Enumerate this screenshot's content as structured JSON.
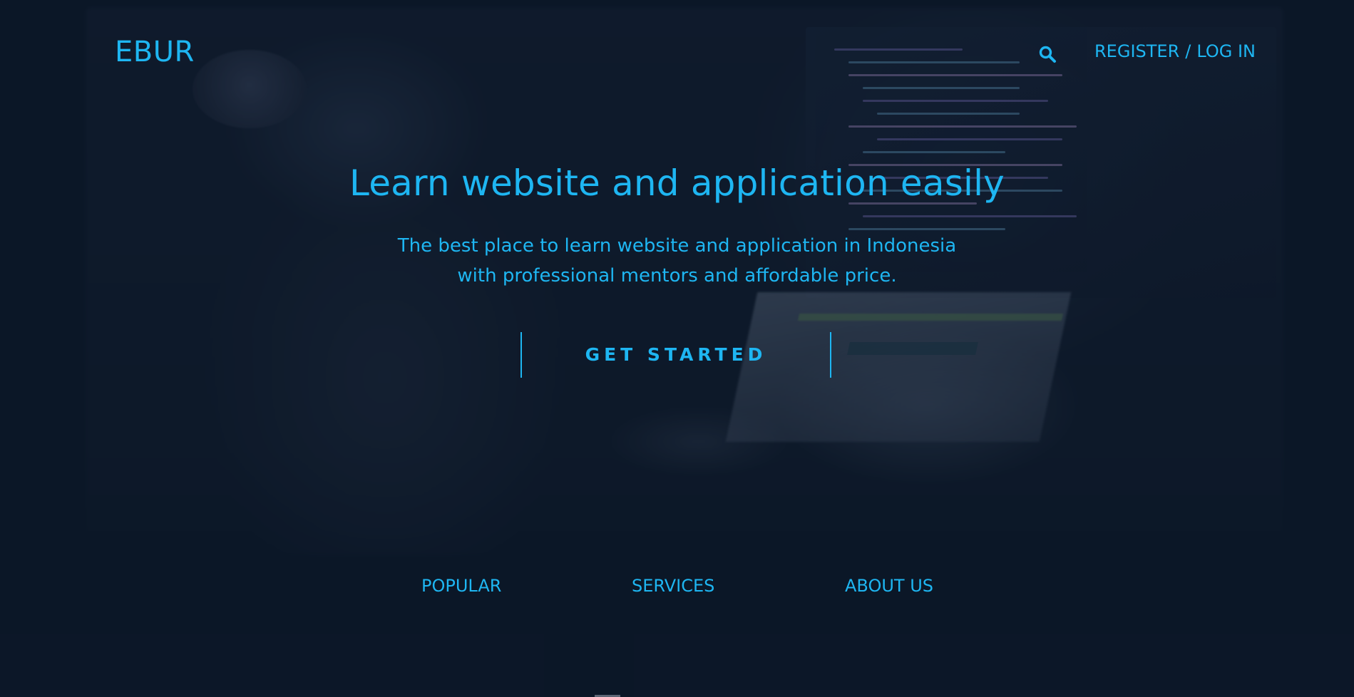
{
  "header": {
    "brand": "EBUR",
    "search_icon": "search-icon",
    "register_label": "REGISTER",
    "separator": "/",
    "login_label": "LOG IN"
  },
  "hero": {
    "title": "Learn website and application easily",
    "subtitle_line1": "The best place to learn website and application in Indonesia",
    "subtitle_line2": "with professional mentors and affordable price.",
    "cta_label": "GET STARTED"
  },
  "bottom_nav": {
    "items": [
      {
        "label": "POPULAR"
      },
      {
        "label": "SERVICES"
      },
      {
        "label": "ABOUT US"
      }
    ]
  },
  "colors": {
    "accent": "#1eb6f2",
    "background": "#0c1829"
  }
}
